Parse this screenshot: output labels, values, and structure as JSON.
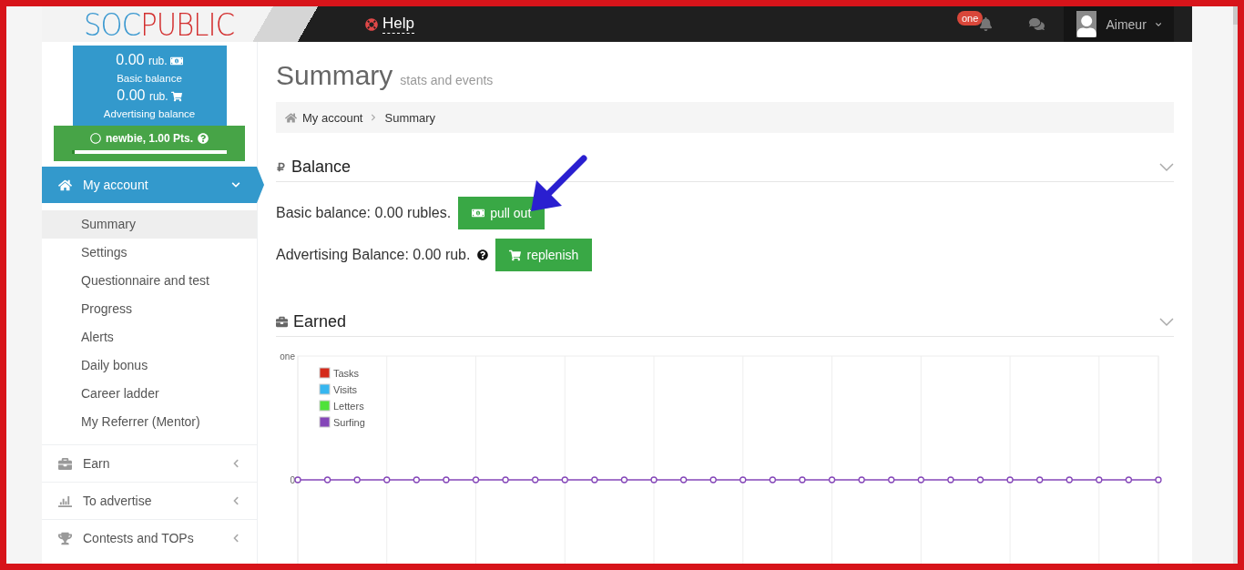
{
  "header": {
    "logo": {
      "part_1": "SOC",
      "part_2": "PUBLIC"
    },
    "help": "Help",
    "notifications_badge": "one",
    "user": {
      "name": "Aimeur"
    }
  },
  "sidebar": {
    "wallet": {
      "basic_amount": "0.00",
      "basic_unit": "rub.",
      "basic_label": "Basic balance",
      "ad_amount": "0.00",
      "ad_unit": "rub.",
      "ad_label": "Advertising balance"
    },
    "rank": {
      "text": "newbie, 1.00 Pts.",
      "level": 0.02
    },
    "menu": [
      {
        "label": "My account",
        "expanded": true,
        "children": [
          {
            "label": "Summary",
            "selected": true
          },
          {
            "label": "Settings",
            "selected": false
          },
          {
            "label": "Questionnaire and test",
            "selected": false
          },
          {
            "label": "Progress",
            "selected": false
          },
          {
            "label": "Alerts",
            "selected": false
          },
          {
            "label": "Daily bonus",
            "selected": false
          },
          {
            "label": "Career ladder",
            "selected": false
          },
          {
            "label": "My Referrer (Mentor)",
            "selected": false
          }
        ]
      },
      {
        "label": "Earn",
        "expanded": false
      },
      {
        "label": "To advertise",
        "expanded": false
      },
      {
        "label": "Contests and TOPs",
        "expanded": false
      }
    ]
  },
  "page": {
    "title": "Summary",
    "subtitle": "stats and events",
    "breadcrumb": [
      "My account",
      "Summary"
    ]
  },
  "balance": {
    "title": "Balance",
    "rows": [
      {
        "text": "Basic balance: 0.00 rubles.",
        "button": "pull out",
        "kind": "cash",
        "help": false
      },
      {
        "text": "Advertising Balance: 0.00 rub.",
        "button": "replenish",
        "kind": "cart",
        "help": true
      }
    ]
  },
  "earned": {
    "title": "Earned",
    "y_axis_labels": [
      "one",
      "0"
    ],
    "legend": [
      {
        "name": "Tasks",
        "color": "#d42a1a"
      },
      {
        "name": "Visits",
        "color": "#36b6f0"
      },
      {
        "name": "Letters",
        "color": "#4fe23a"
      },
      {
        "name": "Surfing",
        "color": "#8446b8"
      }
    ]
  }
}
